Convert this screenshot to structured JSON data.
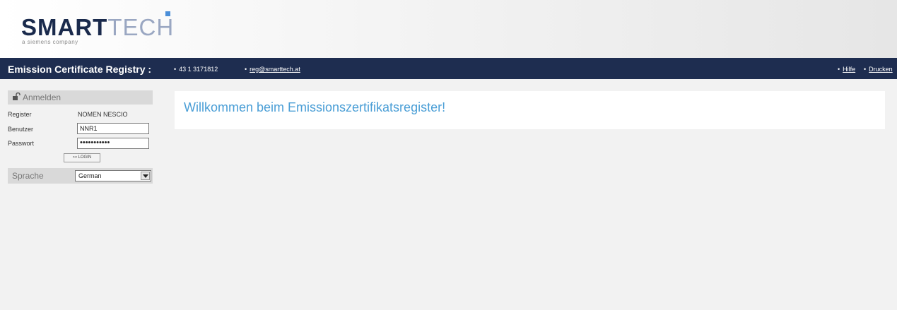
{
  "brand": {
    "name_bold": "SMART",
    "name_light": "TECH",
    "tagline": "a siemens company",
    "accent": "#4a8ed8"
  },
  "navbar": {
    "title": "Emission Certificate Registry :",
    "phone": "43 1 3171812",
    "email": "reg@smarttech.at",
    "links": [
      "Hilfe",
      "Drucken"
    ],
    "background": "#1e2d50"
  },
  "login": {
    "header": "Anmelden",
    "header_icon": "lock-open-icon",
    "register_label": "Register",
    "register_value": "NOMEN NESCIO",
    "user_label": "Benutzer",
    "user_value": "NNR1",
    "password_label": "Passwort",
    "password_value": "•••••••••••",
    "login_button": "LOGIN"
  },
  "language": {
    "label": "Sprache",
    "selected": "German"
  },
  "main": {
    "welcome": "Willkommen beim Emissionszertifikatsregister!",
    "welcome_color": "#4a9ed6"
  }
}
